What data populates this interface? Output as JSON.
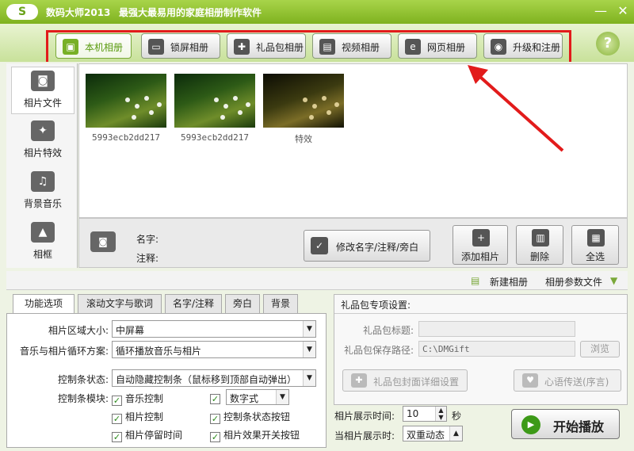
{
  "window": {
    "logo": "S",
    "app_name": "数码大师2013",
    "slogan": "最强大最易用的家庭相册制作软件",
    "minimize": "—",
    "close": "✕"
  },
  "tabs": [
    {
      "label": "本机相册",
      "icon": "photo-album-icon",
      "active": true
    },
    {
      "label": "锁屏相册",
      "icon": "monitor-icon",
      "active": false
    },
    {
      "label": "礼品包相册",
      "icon": "gift-icon",
      "active": false
    },
    {
      "label": "视频相册",
      "icon": "film-icon",
      "active": false
    },
    {
      "label": "网页相册",
      "icon": "ie-browser-icon",
      "active": false
    },
    {
      "label": "升级和注册",
      "icon": "globe-icon",
      "active": false
    }
  ],
  "help": "?",
  "sidebar": {
    "items": [
      {
        "label": "相片文件",
        "icon": "camera-icon",
        "active": true
      },
      {
        "label": "相片特效",
        "icon": "effects-icon",
        "active": false
      },
      {
        "label": "背景音乐",
        "icon": "music-note-icon",
        "active": false
      },
      {
        "label": "相框",
        "icon": "frame-icon",
        "active": false
      }
    ]
  },
  "photos": [
    {
      "name": "5993ecb2dd217"
    },
    {
      "name": "5993ecb2dd217"
    },
    {
      "name": "特效"
    }
  ],
  "info_bar": {
    "name_label": "名字:",
    "note_label": "注释:",
    "edit_button": "修改名字/注释/旁白",
    "add_button": "添加相片",
    "delete_button": "删除",
    "select_all_button": "全选"
  },
  "strip": {
    "new_album": "新建相册",
    "album_params": "相册参数文件"
  },
  "settings_tabs": [
    {
      "label": "功能选项",
      "active": true
    },
    {
      "label": "滚动文字与歌词",
      "active": false
    },
    {
      "label": "名字/注释",
      "active": false
    },
    {
      "label": "旁白",
      "active": false
    },
    {
      "label": "背景",
      "active": false
    }
  ],
  "settings": {
    "photo_size_label": "相片区域大小:",
    "photo_size_value": "中屏幕",
    "loop_label": "音乐与相片循环方案:",
    "loop_value": "循环播放音乐与相片",
    "control_state_label": "控制条状态:",
    "control_state_value": "自动隐藏控制条（鼠标移到顶部自动弹出）",
    "control_module_label": "控制条模块:",
    "checks": {
      "music_control": "音乐控制",
      "digital": "数字式",
      "photo_control": "相片控制",
      "status_button": "控制条状态按钮",
      "photo_stay": "相片停留时间",
      "effect_switch": "相片效果开关按钮"
    },
    "checkmark": "✓"
  },
  "gift": {
    "title": "礼品包专项设置:",
    "gift_title_label": "礼品包标题:",
    "gift_title_value": "",
    "save_path_label": "礼品包保存路径:",
    "save_path_value": "C:\\DMGift",
    "browse_button": "浏览",
    "cover_button": "礼品包封面详细设置",
    "message_button": "心语传送(序言)"
  },
  "timing": {
    "display_time_label": "相片展示时间:",
    "display_time_value": "10",
    "display_time_unit": "秒",
    "when_display_label": "当相片展示时:",
    "when_display_value": "双重动态"
  },
  "play_button": "开始播放"
}
